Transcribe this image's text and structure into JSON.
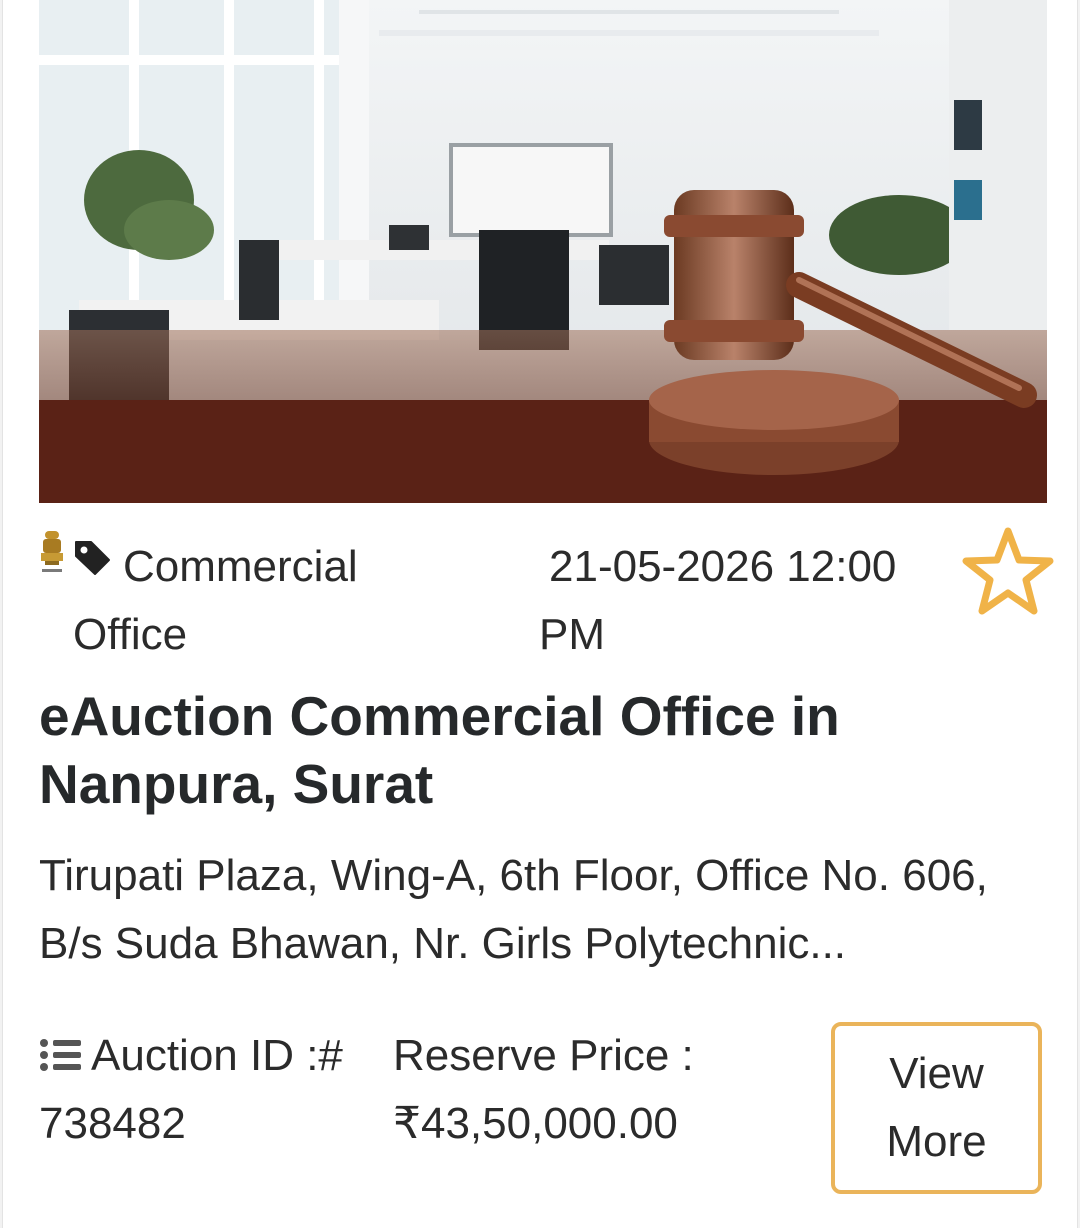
{
  "listing": {
    "image_alt": "Office interior with auction gavel",
    "category": "Commercial Office",
    "category_line1": "Commercial",
    "category_line2": "Office",
    "date_line1": "21-05-2026 12:00",
    "date_line2": "PM",
    "title": "eAuction Commercial Office in Nanpura, Surat",
    "address_line1": "Tirupati Plaza, Wing-A, 6th Floor, Office No. 606,",
    "address_line2": "B/s Suda Bhawan, Nr. Girls Polytechnic...",
    "auction_id_label": "Auction ID :#",
    "auction_id_value": "738482",
    "reserve_price_label": "Reserve Price :",
    "reserve_price_value": "₹43,50,000.00",
    "view_more_label": "View More"
  },
  "icons": {
    "emblem": "national-emblem-icon",
    "tag": "tag-icon",
    "favorite": "star-outline-icon",
    "list": "list-icon"
  },
  "colors": {
    "accent": "#eab45a",
    "star": "#f0b348",
    "banner_bottom": "#5a2216",
    "text": "#2b2b2b",
    "title": "#26292b"
  }
}
